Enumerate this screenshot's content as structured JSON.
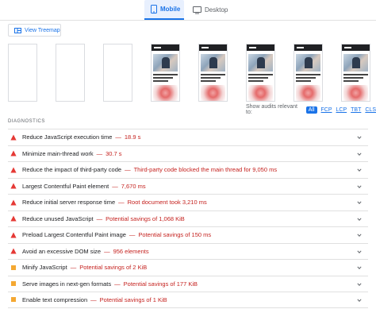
{
  "tabs": {
    "mobile": "Mobile",
    "desktop": "Desktop"
  },
  "treemap": {
    "label": "View Treemap"
  },
  "filter": {
    "label": "Show audits relevant to:",
    "chips": [
      "All",
      "FCP",
      "LCP",
      "TBT",
      "CLS"
    ]
  },
  "diagnostics": {
    "title": "DIAGNOSTICS",
    "items": [
      {
        "title": "Reduce JavaScript execution time",
        "value": "18.9 s",
        "severity": "fail"
      },
      {
        "title": "Minimize main-thread work",
        "value": "30.7 s",
        "severity": "fail"
      },
      {
        "title": "Reduce the impact of third-party code",
        "value": "Third-party code blocked the main thread for 9,050 ms",
        "severity": "fail"
      },
      {
        "title": "Largest Contentful Paint element",
        "value": "7,670 ms",
        "severity": "fail"
      },
      {
        "title": "Reduce initial server response time",
        "value": "Root document took 3,210 ms",
        "severity": "fail"
      },
      {
        "title": "Reduce unused JavaScript",
        "value": "Potential savings of 1,068 KiB",
        "severity": "fail"
      },
      {
        "title": "Preload Largest Contentful Paint image",
        "value": "Potential savings of 150 ms",
        "severity": "fail"
      },
      {
        "title": "Avoid an excessive DOM size",
        "value": "956 elements",
        "severity": "fail"
      },
      {
        "title": "Minify JavaScript",
        "value": "Potential savings of 2 KiB",
        "severity": "average"
      },
      {
        "title": "Serve images in next-gen formats",
        "value": "Potential savings of 177 KiB",
        "severity": "average"
      },
      {
        "title": "Enable text compression",
        "value": "Potential savings of 1 KiB",
        "severity": "average"
      }
    ]
  },
  "colors": {
    "fail": "#e53935",
    "average": "#f4a832",
    "accent": "#1a73e8"
  }
}
